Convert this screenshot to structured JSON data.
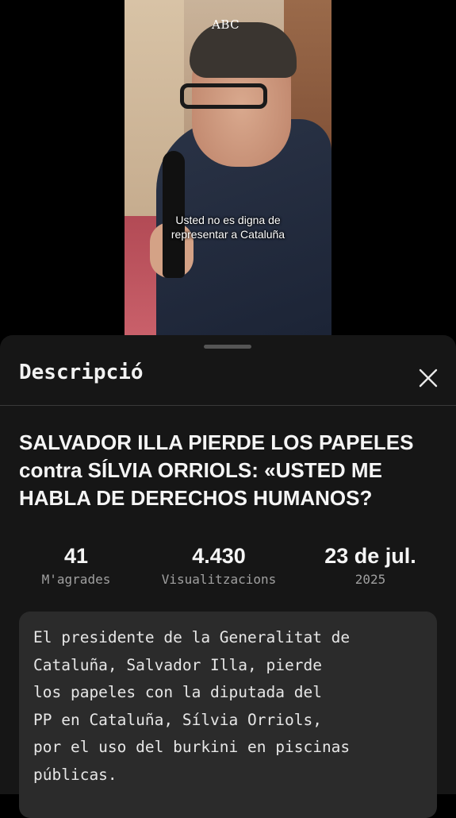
{
  "video": {
    "channel_logo": "ABC",
    "subtitle": "Usted no es digna de\nrepresentar a Cataluña"
  },
  "sheet": {
    "title": "Descripció",
    "close_icon": "close-icon"
  },
  "video_title": "SALVADOR ILLA PIERDE LOS PAPELES contra SÍLVIA ORRIOLS: «USTED ME HABLA DE DERECHOS HUMANOS?",
  "stats": {
    "likes": {
      "value": "41",
      "label": "M'agrades"
    },
    "views": {
      "value": "4.430",
      "label": "Visualitzacions"
    },
    "date": {
      "value": "23 de jul.",
      "label": "2025"
    }
  },
  "description": "El presidente de la Generalitat de\nCataluña, Salvador Illa, pierde\nlos papeles con la diputada del\nPP en Cataluña, Sílvia Orriols,\npor el uso del burkini en piscinas\npúblicas."
}
